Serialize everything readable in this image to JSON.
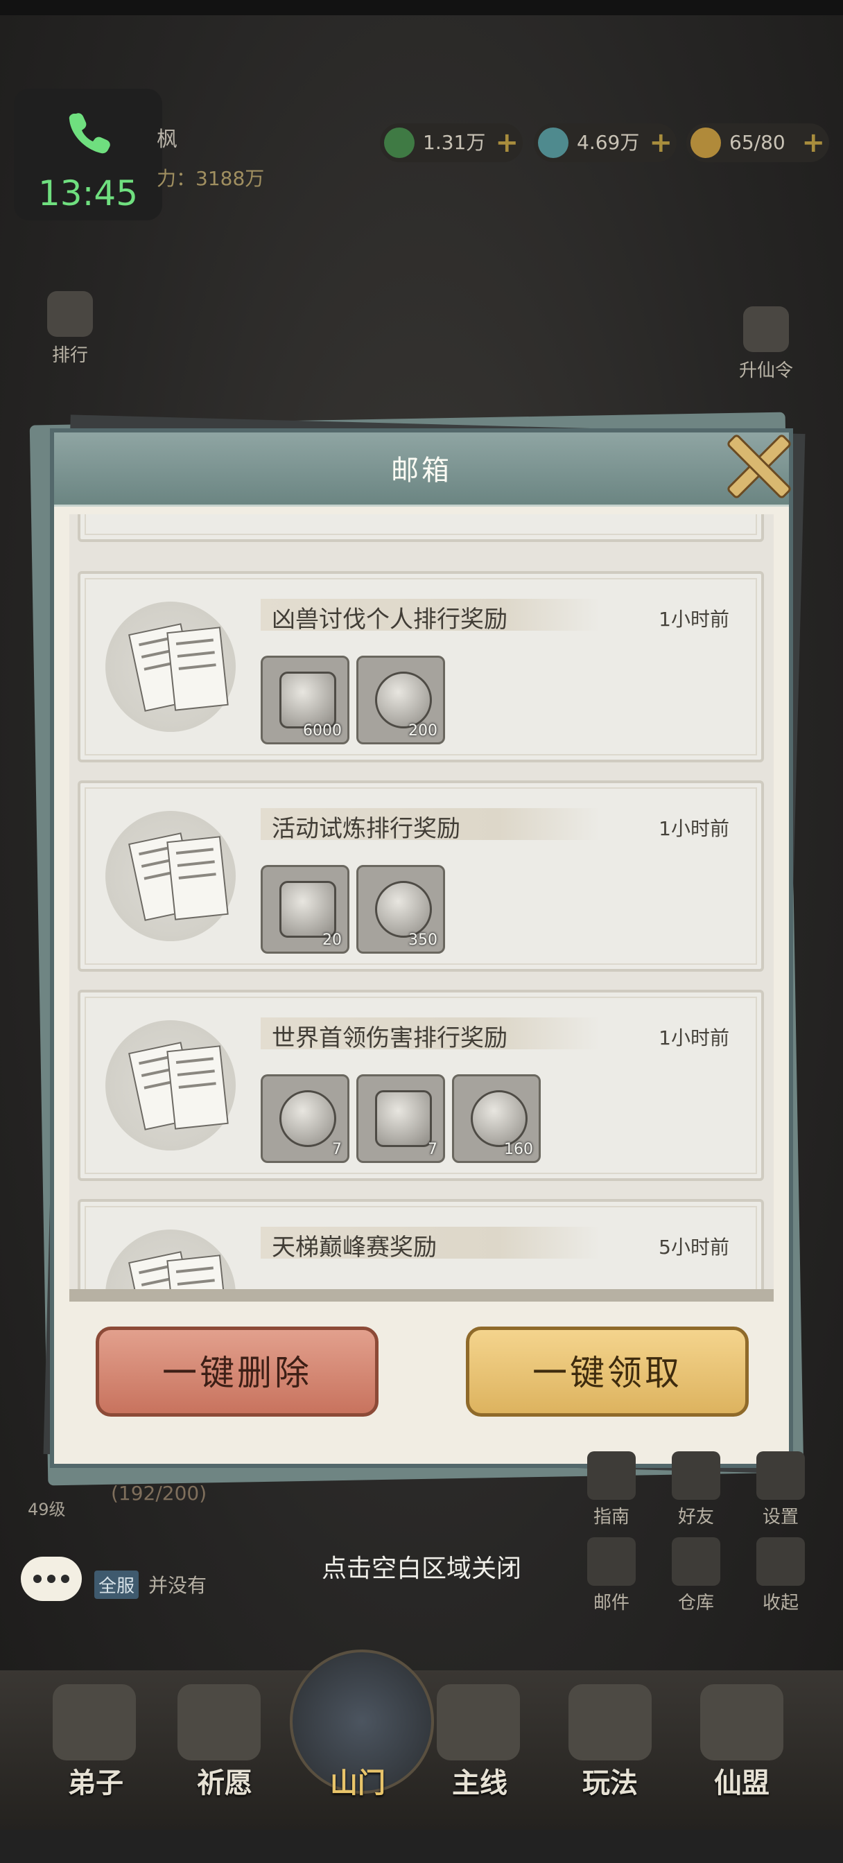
{
  "status": {
    "call_time": "13:45"
  },
  "player": {
    "name": "枫",
    "power": "力：3188万"
  },
  "resources": [
    {
      "value": "1.31万",
      "color": "#3f7a44"
    },
    {
      "value": "4.69万",
      "color": "#4f8a8e"
    },
    {
      "value": "65/80",
      "color": "#b08a3a"
    }
  ],
  "left_menu": [
    "排行"
  ],
  "right_menu_top": [
    "升仙令"
  ],
  "dialog": {
    "title": "邮箱",
    "mails": [
      {
        "title": "凶兽讨伐个人排行奖励",
        "time": "1小时前",
        "items": [
          {
            "count": "6000",
            "icon": "gem-icon"
          },
          {
            "count": "200",
            "icon": "coin-icon"
          }
        ]
      },
      {
        "title": "活动试炼排行奖励",
        "time": "1小时前",
        "items": [
          {
            "count": "20",
            "icon": "token-icon"
          },
          {
            "count": "350",
            "icon": "coin-icon"
          }
        ]
      },
      {
        "title": "世界首领伤害排行奖励",
        "time": "1小时前",
        "items": [
          {
            "count": "7",
            "icon": "scroll-icon"
          },
          {
            "count": "7",
            "icon": "chest-icon"
          },
          {
            "count": "160",
            "icon": "ore-icon"
          }
        ]
      },
      {
        "title": "天梯巅峰赛奖励",
        "time": "5小时前",
        "items": []
      }
    ],
    "delete_all": "一键删除",
    "claim_all": "一键领取"
  },
  "hint": "点击空白区域关闭",
  "chat": {
    "tag": "全服",
    "text": "并没有"
  },
  "level": "49级",
  "exp": "(192/200)",
  "right_menu": {
    "row1": [
      "指南",
      "好友",
      "设置"
    ],
    "row2": [
      "邮件",
      "仓库",
      "收起"
    ]
  },
  "nav": [
    "弟子",
    "祈愿",
    "山门",
    "主线",
    "玩法",
    "仙盟"
  ]
}
